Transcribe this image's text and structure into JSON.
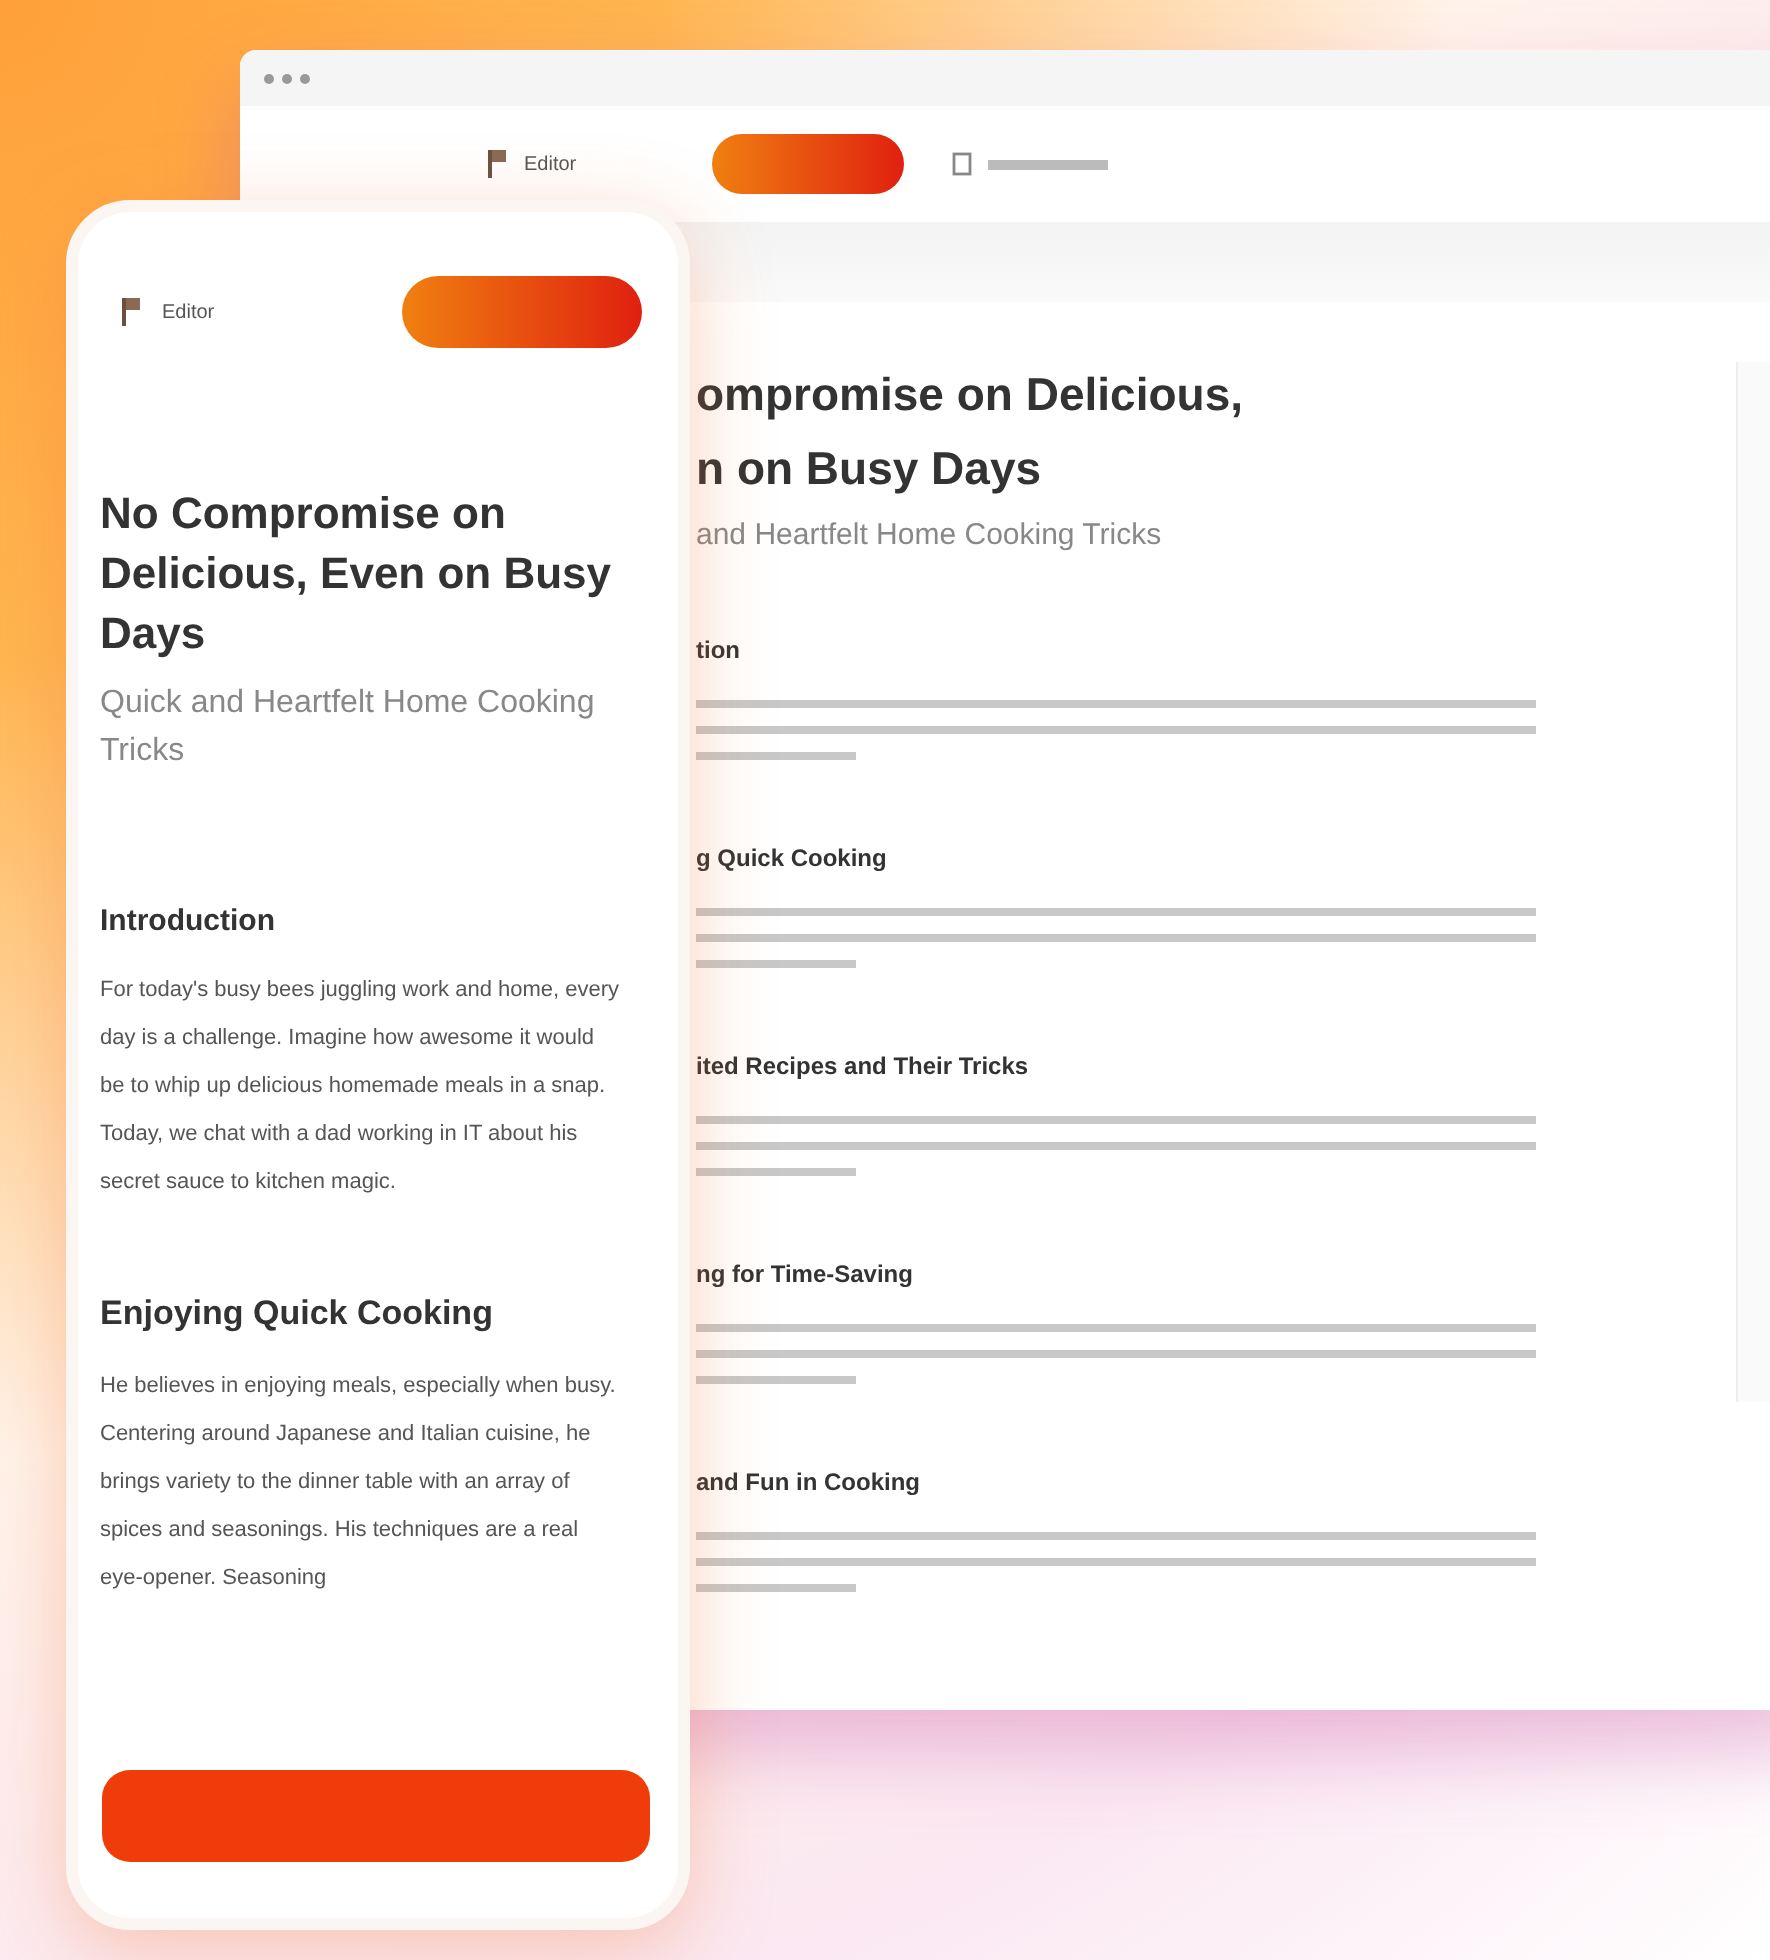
{
  "browser": {
    "brand": "Editor",
    "article": {
      "title_lines": [
        "ompromise on Delicious,",
        "n on Busy Days"
      ],
      "subtitle": "and Heartfelt Home Cooking Tricks",
      "sections": [
        {
          "heading": "tion"
        },
        {
          "heading": "g Quick Cooking"
        },
        {
          "heading": "ited Recipes and Their Tricks"
        },
        {
          "heading": "ng for Time-Saving"
        },
        {
          "heading": "and Fun in Cooking"
        }
      ]
    }
  },
  "phone": {
    "brand": "Editor",
    "title": "No Compromise on Delicious, Even on Busy Days",
    "subtitle": "Quick and Heartfelt Home Cooking Tricks",
    "sections": [
      {
        "heading": "Introduction",
        "body": "For today's busy bees juggling work and home, every day is a challenge. Imagine how awesome it would be to whip up delicious homemade meals in a snap. Today, we chat with a dad working in IT about his secret sauce to kitchen magic."
      },
      {
        "heading": "Enjoying Quick Cooking",
        "body": "He believes in enjoying meals, especially when busy. Centering around Japanese and Italian cuisine, he brings variety to the dinner table with an array of spices and seasonings. His techniques are a real eye-opener. Seasoning"
      }
    ]
  }
}
